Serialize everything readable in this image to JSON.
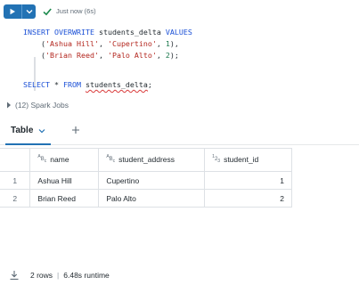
{
  "toolbar": {
    "status_text": "Just now (6s)",
    "run_icon": "play-icon",
    "caret_icon": "chevron-down-icon",
    "status_icon": "check-icon",
    "accent": "#2272b4",
    "success": "#1d8a4e"
  },
  "code": {
    "l1_kw1": "INSERT",
    "l1_kw2": "OVERWRITE",
    "l1_name": "students_delta",
    "l1_kw3": "VALUES",
    "l2_open": "(",
    "l2_s1": "'Ashua Hill'",
    "l2_sep1": ", ",
    "l2_s2": "'Cupertino'",
    "l2_sep2": ", ",
    "l2_n": "1",
    "l2_close": "),",
    "l3_open": "(",
    "l3_s1": "'Brian Reed'",
    "l3_sep1": ", ",
    "l3_s2": "'Palo Alto'",
    "l3_sep2": ", ",
    "l3_n": "2",
    "l3_close": ");",
    "l5_kw1": "SELECT",
    "l5_star": "*",
    "l5_kw2": "FROM",
    "l5_name": "students_delta",
    "l5_end": ";"
  },
  "spark": {
    "label": "(12) Spark Jobs"
  },
  "tabs": {
    "table_label": "Table"
  },
  "table": {
    "columns": [
      {
        "type_icon": "A B c",
        "label": "name"
      },
      {
        "type_icon": "A B c",
        "label": "student_address"
      },
      {
        "type_icon": "1 2 3",
        "label": "student_id"
      }
    ],
    "rows": [
      {
        "index": "1",
        "name": "Ashua Hill",
        "address": "Cupertino",
        "id": "1"
      },
      {
        "index": "2",
        "name": "Brian Reed",
        "address": "Palo Alto",
        "id": "2"
      }
    ]
  },
  "footer": {
    "rows_text": "2 rows",
    "separator": "|",
    "runtime_text": "6.48s runtime"
  }
}
